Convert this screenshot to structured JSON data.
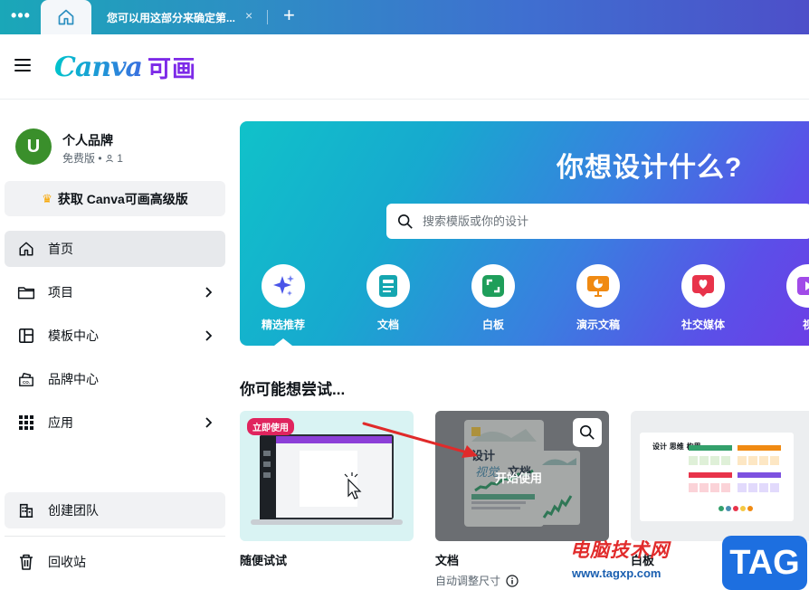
{
  "browser": {
    "menu_glyph": "•••",
    "active_tab_title": "您可以用这部分来确定第...",
    "close_glyph": "×",
    "new_tab_glyph": "+"
  },
  "header": {
    "logo_word": "Canva",
    "logo_cn": "可画"
  },
  "sidebar": {
    "account": {
      "initial": "U",
      "name": "个人品牌",
      "plan": "免费版 • ",
      "member_count": "1"
    },
    "upgrade_label": "获取 Canva可画高级版",
    "items": [
      {
        "label": "首页",
        "icon": "home-icon",
        "active": true
      },
      {
        "label": "项目",
        "icon": "folder-icon",
        "chevron": true
      },
      {
        "label": "模板中心",
        "icon": "template-icon",
        "chevron": true
      },
      {
        "label": "品牌中心",
        "icon": "brand-icon"
      },
      {
        "label": "应用",
        "icon": "apps-grid-icon",
        "chevron": true
      }
    ],
    "create_team_label": "创建团队",
    "trash_label": "回收站"
  },
  "hero": {
    "title": "你想设计什么?",
    "search_placeholder": "搜索模版或你的设计",
    "categories": [
      {
        "label": "精选推荐",
        "icon": "sparkle-icon",
        "color": "#4a55e8"
      },
      {
        "label": "文档",
        "icon": "document-icon",
        "color": "#15a6b0"
      },
      {
        "label": "白板",
        "icon": "whiteboard-icon",
        "color": "#1e9e5a"
      },
      {
        "label": "演示文稿",
        "icon": "presentation-icon",
        "color": "#f08a12"
      },
      {
        "label": "社交媒体",
        "icon": "heart-icon",
        "color": "#e8334a"
      },
      {
        "label": "视",
        "icon": "video-icon",
        "color": "#a14be8"
      }
    ]
  },
  "suggestions": {
    "title": "你可能想尝试...",
    "cards": [
      {
        "label": "随便试试",
        "badge": "立即使用"
      },
      {
        "label": "文档",
        "sub": "自动调整尺寸",
        "overlay": "开始使用",
        "thumb_title": "设计",
        "thumb_title2": "视觉",
        "thumb_word": "文档"
      },
      {
        "label": "白板",
        "thumb_text": "设计 思维 构思"
      }
    ]
  },
  "watermark": {
    "site_name": "电脑技术网",
    "url": "www.tagxp.com",
    "badge": "TAG"
  }
}
